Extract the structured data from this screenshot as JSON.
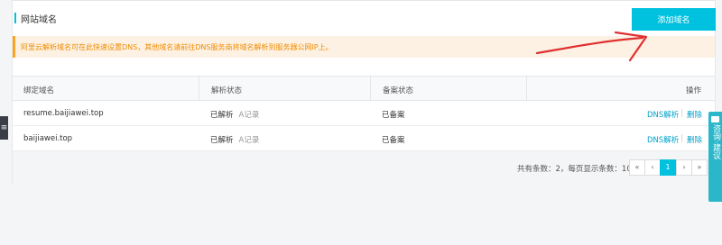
{
  "header": {
    "title": "网站域名",
    "add_button": "添加域名"
  },
  "notice": {
    "text": "阿里云解析域名可在此快速设置DNS，其他域名请前往DNS服务商将域名解析到服务器公网IP上。"
  },
  "table": {
    "columns": [
      "绑定域名",
      "解析状态",
      "备案状态",
      "操作"
    ],
    "rows": [
      {
        "domain": "resume.baijiawei.top",
        "resolve_status": "已解析",
        "record_type": "A记录",
        "icp_status": "已备案",
        "op_dns": "DNS解析",
        "op_sep": "|",
        "op_delete": "删除"
      },
      {
        "domain": "baijiawei.top",
        "resolve_status": "已解析",
        "record_type": "A记录",
        "icp_status": "已备案",
        "op_dns": "DNS解析",
        "op_sep": "|",
        "op_delete": "删除"
      }
    ]
  },
  "pagination": {
    "summary": "共有条数：2，每页显示条数：10",
    "first": "«",
    "prev": "‹",
    "current": "1",
    "next": "›",
    "last": "»"
  },
  "side": {
    "left_tab": "≡",
    "consult": "咨询·建议"
  },
  "colors": {
    "accent": "#00c1de",
    "notice_bg": "#fdf1e3",
    "notice_text": "#f08c00",
    "link": "#00a2ca",
    "annotation": "#e03030"
  }
}
